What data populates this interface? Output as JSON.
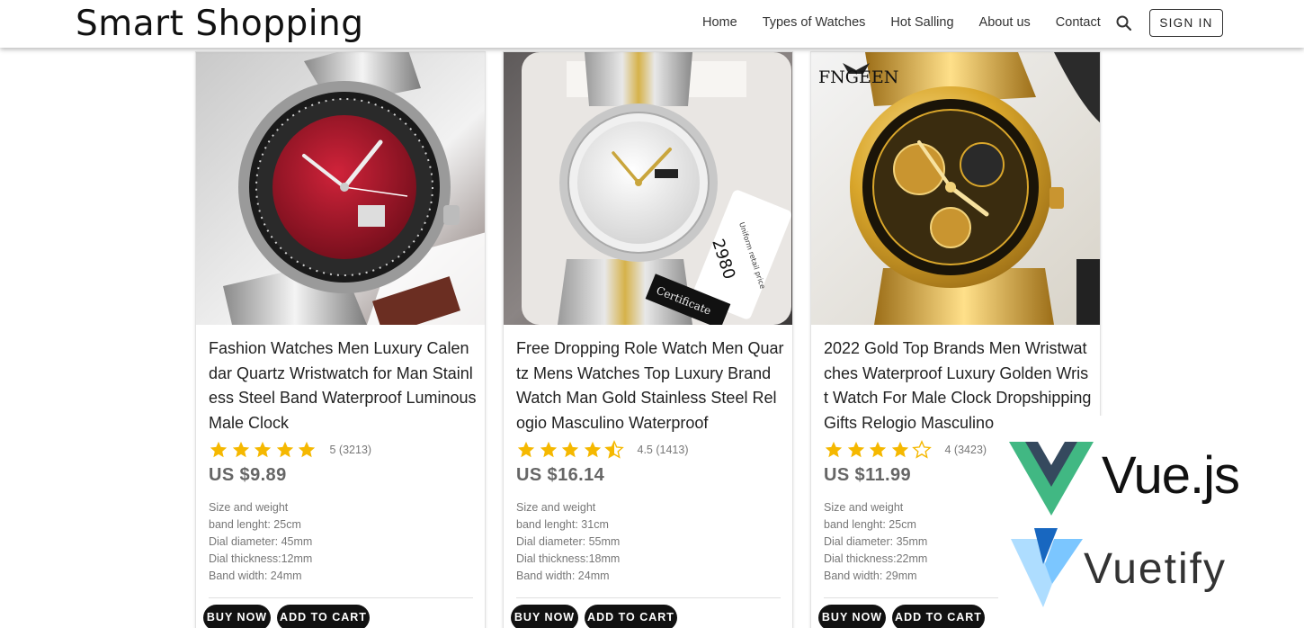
{
  "app": {
    "brand": "Smart Shopping"
  },
  "nav": {
    "items": [
      "Home",
      "Types of Watches",
      "Hot Salling",
      "About us",
      "Contact"
    ]
  },
  "header": {
    "signin_label": "SIGN IN",
    "search_icon": "search-icon"
  },
  "colors": {
    "star": "#f5b800",
    "button_bg": "#111111",
    "vue_green": "#41b883",
    "vue_dark": "#35495e",
    "vuetify_blue": "#1867c0",
    "vuetify_light": "#aeddff"
  },
  "products": [
    {
      "title": "Fashion Watches Men Luxury Calendar Quartz Wristwatch for Man Stainless Steel Band Waterproof Luminous Male Clock",
      "rating": 5,
      "rating_text": "5 (3213)",
      "price": "US $9.89",
      "specs_heading": "Size and weight",
      "specs": [
        "band lenght: 25cm",
        "Dial diameter: 45mm",
        "Dial thickness:12mm",
        "Band width: 24mm"
      ],
      "buy_label": "BUY NOW",
      "cart_label": "ADD TO CART",
      "image": "red-dial-silver-watch"
    },
    {
      "title": "Free Dropping Role Watch Men Quartz Mens Watches Top Luxury Brand Watch Man Gold Stainless Steel Relogio Masculino Waterproof",
      "rating": 4.5,
      "rating_text": "4.5 (1413)",
      "price": "US $16.14",
      "specs_heading": "Size and weight",
      "specs": [
        "band lenght: 31cm",
        "Dial diameter: 55mm",
        "Dial thickness:18mm",
        "Band width: 24mm"
      ],
      "buy_label": "BUY NOW",
      "cart_label": "ADD TO CART",
      "image": "white-dial-two-tone-watch",
      "image_text": {
        "tag": "2980",
        "tag_small": "Uniform retail price",
        "certificate": "Certificate"
      }
    },
    {
      "title": "2022 Gold Top Brands Men Wristwatches Waterproof Luxury Golden Wrist Watch For Male Clock Dropshipping Gifts Relogio Masculino",
      "rating": 4,
      "rating_text": "4 (3423)",
      "price": "US $11.99",
      "specs_heading": "Size and weight",
      "specs": [
        "band lenght: 25cm",
        "Dial diameter: 35mm",
        "Dial thickness:22mm",
        "Band width: 29mm"
      ],
      "buy_label": "BUY NOW",
      "cart_label": "ADD TO CART",
      "image": "gold-skeleton-watch",
      "image_text": {
        "brand": "FNGEEN"
      }
    }
  ],
  "logos": {
    "vue": "Vue.js",
    "vuetify": "Vuetify"
  }
}
